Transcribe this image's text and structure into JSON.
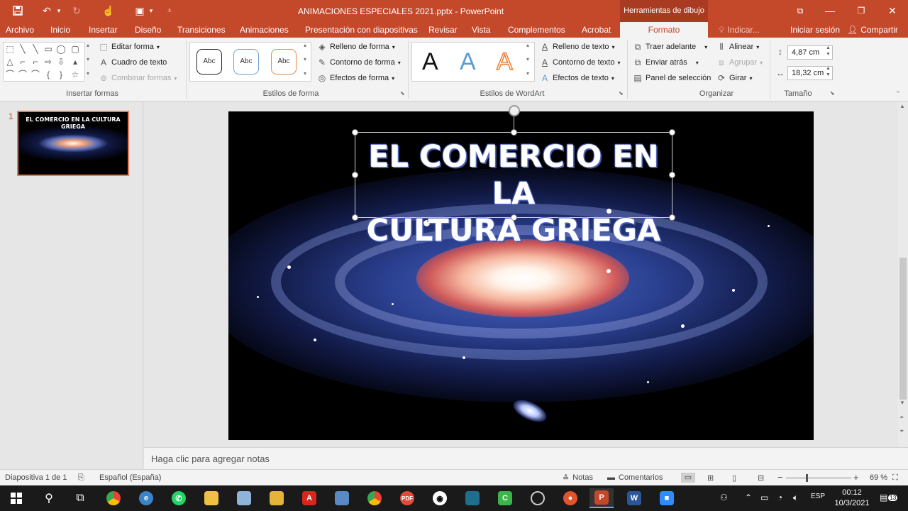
{
  "app": {
    "document_title": "ANIMACIONES ESPECIALES 2021.pptx - PowerPoint",
    "context_tab_group": "Herramientas de dibujo",
    "accent_color": "#c4482a"
  },
  "quick_access": {
    "save_icon": "save-icon",
    "undo_icon": "undo-icon",
    "redo_icon": "redo-icon",
    "touch_icon": "touch-mode-icon",
    "present_icon": "present-icon",
    "customize_icon": "customize-qat-icon"
  },
  "tabs": [
    "Archivo",
    "Inicio",
    "Insertar",
    "Diseño",
    "Transiciones",
    "Animaciones",
    "Presentación con diapositivas",
    "Revisar",
    "Vista",
    "Complementos",
    "Acrobat",
    "Formato"
  ],
  "active_tab": "Formato",
  "tell_me": "Indicar...",
  "sign_in": "Iniciar sesión",
  "share": "Compartir",
  "ribbon": {
    "insert_shapes": {
      "label": "Insertar formas",
      "edit_shape": "Editar forma",
      "text_box": "Cuadro de texto",
      "merge_shapes": "Combinar formas"
    },
    "shape_styles": {
      "label": "Estilos de forma",
      "samples": [
        "Abc",
        "Abc",
        "Abc"
      ],
      "fill": "Relleno de forma",
      "outline": "Contorno de forma",
      "effects": "Efectos de forma"
    },
    "wordart": {
      "label": "Estilos de WordArt",
      "samples": [
        "A",
        "A",
        "A"
      ],
      "text_fill": "Relleno de texto",
      "text_outline": "Contorno de texto",
      "text_effects": "Efectos de texto"
    },
    "arrange": {
      "label": "Organizar",
      "bring_forward": "Traer adelante",
      "send_backward": "Enviar atrás",
      "selection_pane": "Panel de selección",
      "align": "Alinear",
      "group": "Agrupar",
      "rotate": "Girar"
    },
    "size": {
      "label": "Tamaño",
      "height": "4,87 cm",
      "width": "18,32 cm"
    }
  },
  "slides_pane": {
    "slide_number": "1",
    "thumb_title": "EL COMERCIO EN LA CULTURA GRIEGA"
  },
  "slide": {
    "title_line1": "EL COMERCIO EN LA",
    "title_line2": "CULTURA GRIEGA"
  },
  "notes": {
    "placeholder": "Haga clic para agregar notas"
  },
  "status": {
    "slide_of": "Diapositiva 1 de 1",
    "language": "Español (España)",
    "notes_btn": "Notas",
    "comments_btn": "Comentarios",
    "zoom": "69 %",
    "zoom_minus": "−",
    "zoom_plus": "+"
  },
  "taskbar": {
    "language": "ESP",
    "time": "00:12",
    "date": "10/3/2021",
    "notifications": "13"
  }
}
